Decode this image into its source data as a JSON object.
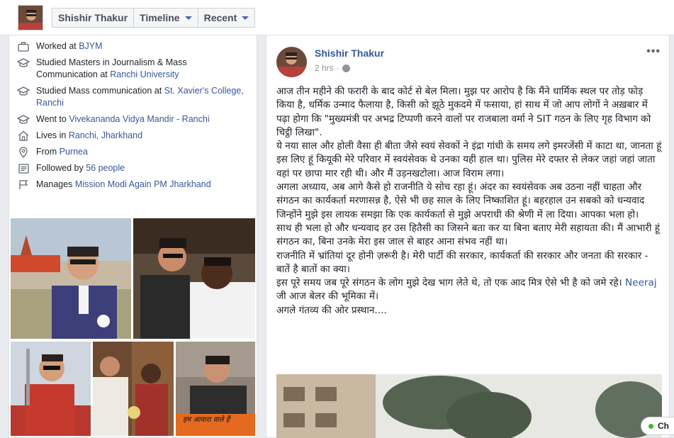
{
  "profile": {
    "name": "Shishir Thakur",
    "tabs": [
      {
        "label": "Shishir Thakur",
        "has_caret": false
      },
      {
        "label": "Timeline",
        "has_caret": true
      },
      {
        "label": "Recent",
        "has_caret": true
      }
    ]
  },
  "intro": {
    "worked": {
      "prefix": "Worked at ",
      "link": "BJYM"
    },
    "studied_masters": {
      "prefix": "Studied Masters in Journalism & Mass Communication at ",
      "link": "Ranchi University"
    },
    "studied_mass": {
      "prefix": "Studied Mass communication at ",
      "link": "St. Xavier's College, Ranchi"
    },
    "went_to": {
      "prefix": "Went to ",
      "link": "Vivekananda Vidya Mandir - Ranchi"
    },
    "lives": {
      "prefix": "Lives in ",
      "link": "Ranchi, Jharkhand"
    },
    "from": {
      "prefix": "From ",
      "link": "Purnea"
    },
    "followed": {
      "prefix": "Followed by ",
      "link": "56 people"
    },
    "manages": {
      "prefix": "Manages ",
      "link": "Mission Modi Again PM Jharkhand"
    }
  },
  "photos": {
    "caption_6": "हम आवारा वाले हैं"
  },
  "post": {
    "author": "Shishir Thakur",
    "time": "2 hrs",
    "time_sep": "·",
    "more": "•••",
    "paragraphs": [
      "आज तीन महीने की फरारी के बाद कोर्ट से बेल मिला। मुझ पर आरोप है कि मैंने धार्मिक स्थल पर तोड़ फोड़ किया है, धर्मिक उन्माद फैलाया है, किसी को झूठे मुकदमे में फसाया, हां साथ में जो आप लोगों ने अख़बार में पढ़ा होगा कि \"मुख्यमंत्री पर अभद्र टिप्पणी करने वालों पर राजबाला वर्मा ने SIT गठन के लिए गृह विभाग को चिट्ठी लिखा\".",
      "ये नया साल और होली वैसा ही बीता जैसे स्वयं सेवकों ने इंद्रा गांधी के समय लगे इमरजेंसी में काटा था, जानता हूं इस लिए हूं कियूकी मेरे परिवार में स्वयंसेवक थे उनका यही हाल था। पुलिस मेरे दफ्तर से लेकर जहां जहां जाता वहां पर छापा मार रही थी। और मैं उड़नखटोला। आज विराम लगा।",
      "अगला अध्याय, अब आगे कैसे हो राजनीति ये सोच रहा हूं। अंदर का स्वयंसेवक अब उठना नहीं चाहता और संगठन का कार्यकर्ता मरणासन्न है, ऐसे भी छह साल के लिए निष्काशित हूं। बहरहाल उन सबको को धन्यवाद जिन्होंने मुझे इस लायक समझा कि एक कार्यकर्ता से मुझे अपराधी की श्रेणी में ला दिया। आपका भला हो।",
      "साथ ही भला हो और धन्यवाद हर उस हितैसी का जिसने बता कर या बिना बताए मेरी सहायता की। मैं आभारी हूं संगठन का, बिना उनके मेरा इस जाल से बाहर आना संभव नहीं था।",
      "राजनीति में भ्रांतियां दूर होनी ज़रूरी है। मेरी पार्टी की सरकार, कार्यकर्ता की सरकार और जनता की सरकार - बातें है बातों का क्या।",
      "इस पूरे समय जब पूरे संगठन के लोग मुझे देख भाग लेते थे, तो एक आद मित्र ऐसे भी है को जमे रहे।"
    ],
    "mention": {
      "name": "Neeraj",
      "rest": " जी आज बेलर की भूमिका में।"
    },
    "closing": "अगले गंतव्य की ओर प्रस्थान...."
  },
  "chat": {
    "label": "Ch"
  },
  "colors": {
    "link": "#365899",
    "background": "#e9ebee",
    "online": "#42b72a"
  }
}
